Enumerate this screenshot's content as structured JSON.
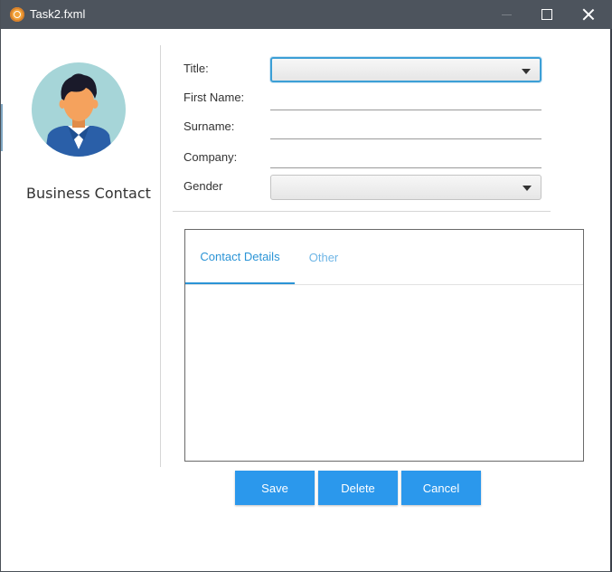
{
  "window": {
    "title": "Task2.fxml",
    "icon": "app-icon"
  },
  "left": {
    "contact_type": "Business Contact",
    "avatar_icon": "person-avatar-icon"
  },
  "form": {
    "title_label": "Title:",
    "title_value": "",
    "first_name_label": "First Name:",
    "first_name_value": "",
    "surname_label": "Surname:",
    "surname_value": "",
    "company_label": "Company:",
    "company_value": "",
    "gender_label": "Gender",
    "gender_value": ""
  },
  "tabs": [
    {
      "label": "Contact Details",
      "active": true
    },
    {
      "label": "Other",
      "active": false
    }
  ],
  "buttons": {
    "save": "Save",
    "delete": "Delete",
    "cancel": "Cancel"
  },
  "colors": {
    "accent": "#2b98ec",
    "titlebar": "#4d545d",
    "tab_active": "#2b94d6"
  }
}
